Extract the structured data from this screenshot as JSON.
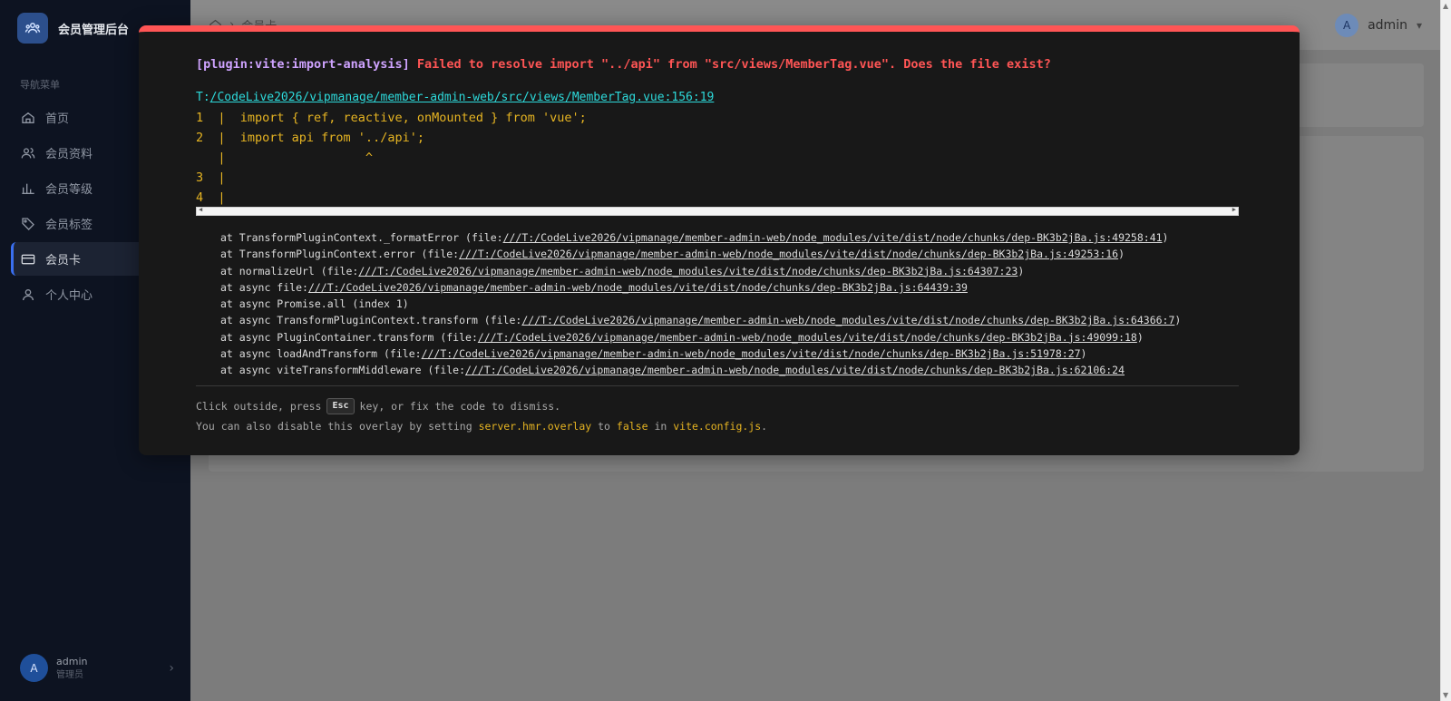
{
  "sidebar": {
    "app_title": "会员管理后台",
    "section_title": "导航菜单",
    "items": [
      {
        "label": "首页",
        "icon": "home-icon"
      },
      {
        "label": "会员资料",
        "icon": "users-icon"
      },
      {
        "label": "会员等级",
        "icon": "bar-chart-icon"
      },
      {
        "label": "会员标签",
        "icon": "tag-icon"
      },
      {
        "label": "会员卡",
        "icon": "card-icon",
        "active": true
      },
      {
        "label": "个人中心",
        "icon": "user-icon"
      }
    ],
    "user": {
      "avatar": "A",
      "name": "admin",
      "role": "管理员"
    }
  },
  "header": {
    "breadcrumb_current": "会员卡",
    "user_avatar": "A",
    "user_name": "admin"
  },
  "error_overlay": {
    "plugin": "[plugin:vite:import-analysis]",
    "message": "Failed to resolve import \"../api\" from \"src/views/MemberTag.vue\". Does the file exist?",
    "file_prefix": "T:",
    "file_path": "/CodeLive2026/vipmanage/member-admin-web/src/views/MemberTag.vue:156:19",
    "frame_lines": [
      "1  |  import { ref, reactive, onMounted } from 'vue';",
      "2  |  import api from '../api';",
      "   |                   ^",
      "3  |",
      "4  |"
    ],
    "stack": [
      {
        "prefix": "at TransformPluginContext._formatError (file:",
        "link": "///T:/CodeLive2026/vipmanage/member-admin-web/node_modules/vite/dist/node/chunks/dep-BK3b2jBa.js:49258:41",
        "suffix": ")"
      },
      {
        "prefix": "at TransformPluginContext.error (file:",
        "link": "///T:/CodeLive2026/vipmanage/member-admin-web/node_modules/vite/dist/node/chunks/dep-BK3b2jBa.js:49253:16",
        "suffix": ")"
      },
      {
        "prefix": "at normalizeUrl (file:",
        "link": "///T:/CodeLive2026/vipmanage/member-admin-web/node_modules/vite/dist/node/chunks/dep-BK3b2jBa.js:64307:23",
        "suffix": ")"
      },
      {
        "prefix": "at async file:",
        "link": "///T:/CodeLive2026/vipmanage/member-admin-web/node_modules/vite/dist/node/chunks/dep-BK3b2jBa.js:64439:39",
        "suffix": ""
      },
      {
        "prefix": "at async Promise.all (index 1)",
        "link": "",
        "suffix": ""
      },
      {
        "prefix": "at async TransformPluginContext.transform (file:",
        "link": "///T:/CodeLive2026/vipmanage/member-admin-web/node_modules/vite/dist/node/chunks/dep-BK3b2jBa.js:64366:7",
        "suffix": ")"
      },
      {
        "prefix": "at async PluginContainer.transform (file:",
        "link": "///T:/CodeLive2026/vipmanage/member-admin-web/node_modules/vite/dist/node/chunks/dep-BK3b2jBa.js:49099:18",
        "suffix": ")"
      },
      {
        "prefix": "at async loadAndTransform (file:",
        "link": "///T:/CodeLive2026/vipmanage/member-admin-web/node_modules/vite/dist/node/chunks/dep-BK3b2jBa.js:51978:27",
        "suffix": ")"
      },
      {
        "prefix": "at async viteTransformMiddleware (file:",
        "link": "///T:/CodeLive2026/vipmanage/member-admin-web/node_modules/vite/dist/node/chunks/dep-BK3b2jBa.js:62106:24",
        "suffix": ""
      }
    ],
    "tip_line1_before": "Click outside, press",
    "tip_key": "Esc",
    "tip_line1_after": "key, or fix the code to dismiss.",
    "tip_line2_a": "You can also disable this overlay by setting ",
    "tip_line2_b": "server.hmr.overlay",
    "tip_line2_c": " to ",
    "tip_line2_d": "false",
    "tip_line2_e": " in ",
    "tip_line2_f": "vite.config.js",
    "tip_line2_g": "."
  },
  "colors": {
    "overlay_accent": "#ff5555",
    "plugin_text": "#cfa3ff",
    "file_link": "#2dd9da",
    "code_frame": "#e6b422",
    "sidebar_bg": "#0d1321"
  }
}
